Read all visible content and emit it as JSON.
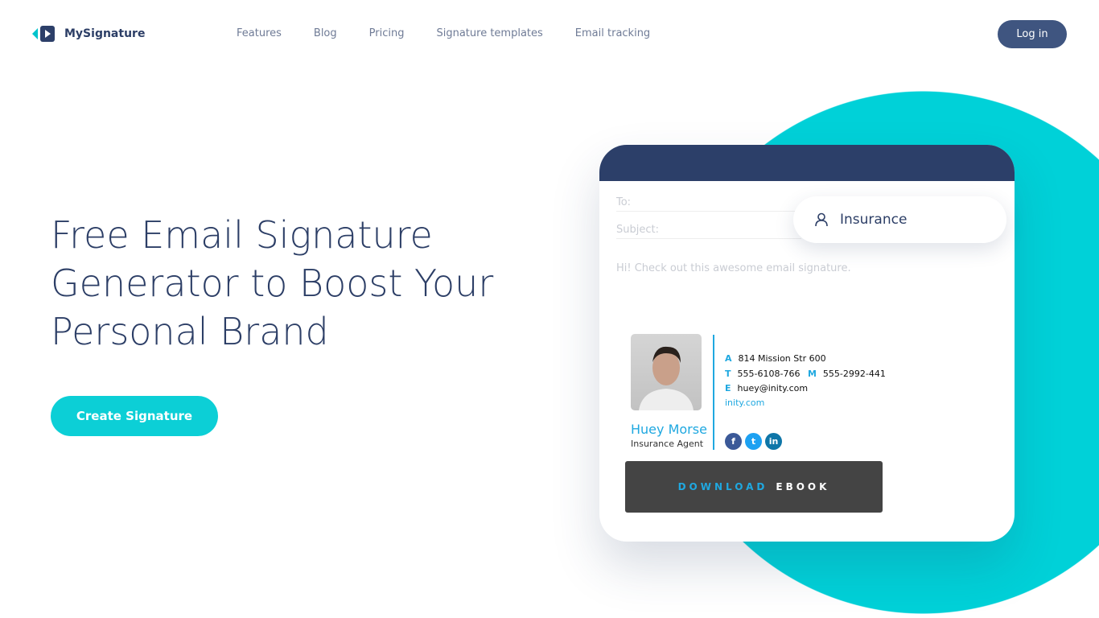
{
  "header": {
    "brand": "MySignature",
    "nav": [
      "Features",
      "Blog",
      "Pricing",
      "Signature templates",
      "Email tracking"
    ],
    "login": "Log in"
  },
  "hero": {
    "title": "Free Email Signature Generator to Boost Your Personal Brand",
    "cta": "Create Signature"
  },
  "mockup": {
    "to_label": "To:",
    "subject_label": "Subject:",
    "message": "Hi! Check out this awesome email signature.",
    "category": "Insurance",
    "signature": {
      "name": "Huey Morse",
      "role": "Insurance Agent",
      "address_label": "A",
      "address": "814 Mission Str 600",
      "phone_label": "T",
      "phone": "555-6108-766",
      "mobile_label": "M",
      "mobile": "555-2992-441",
      "email_label": "E",
      "email": "huey@inity.com",
      "website": "inity.com",
      "socials": [
        "facebook-icon",
        "twitter-icon",
        "linkedin-icon"
      ],
      "banner_left": "DOWNLOAD",
      "banner_right": "EBOOK"
    }
  },
  "colors": {
    "accent": "#00d1d8",
    "navy": "#2c3f69",
    "link": "#1fa8e0"
  }
}
